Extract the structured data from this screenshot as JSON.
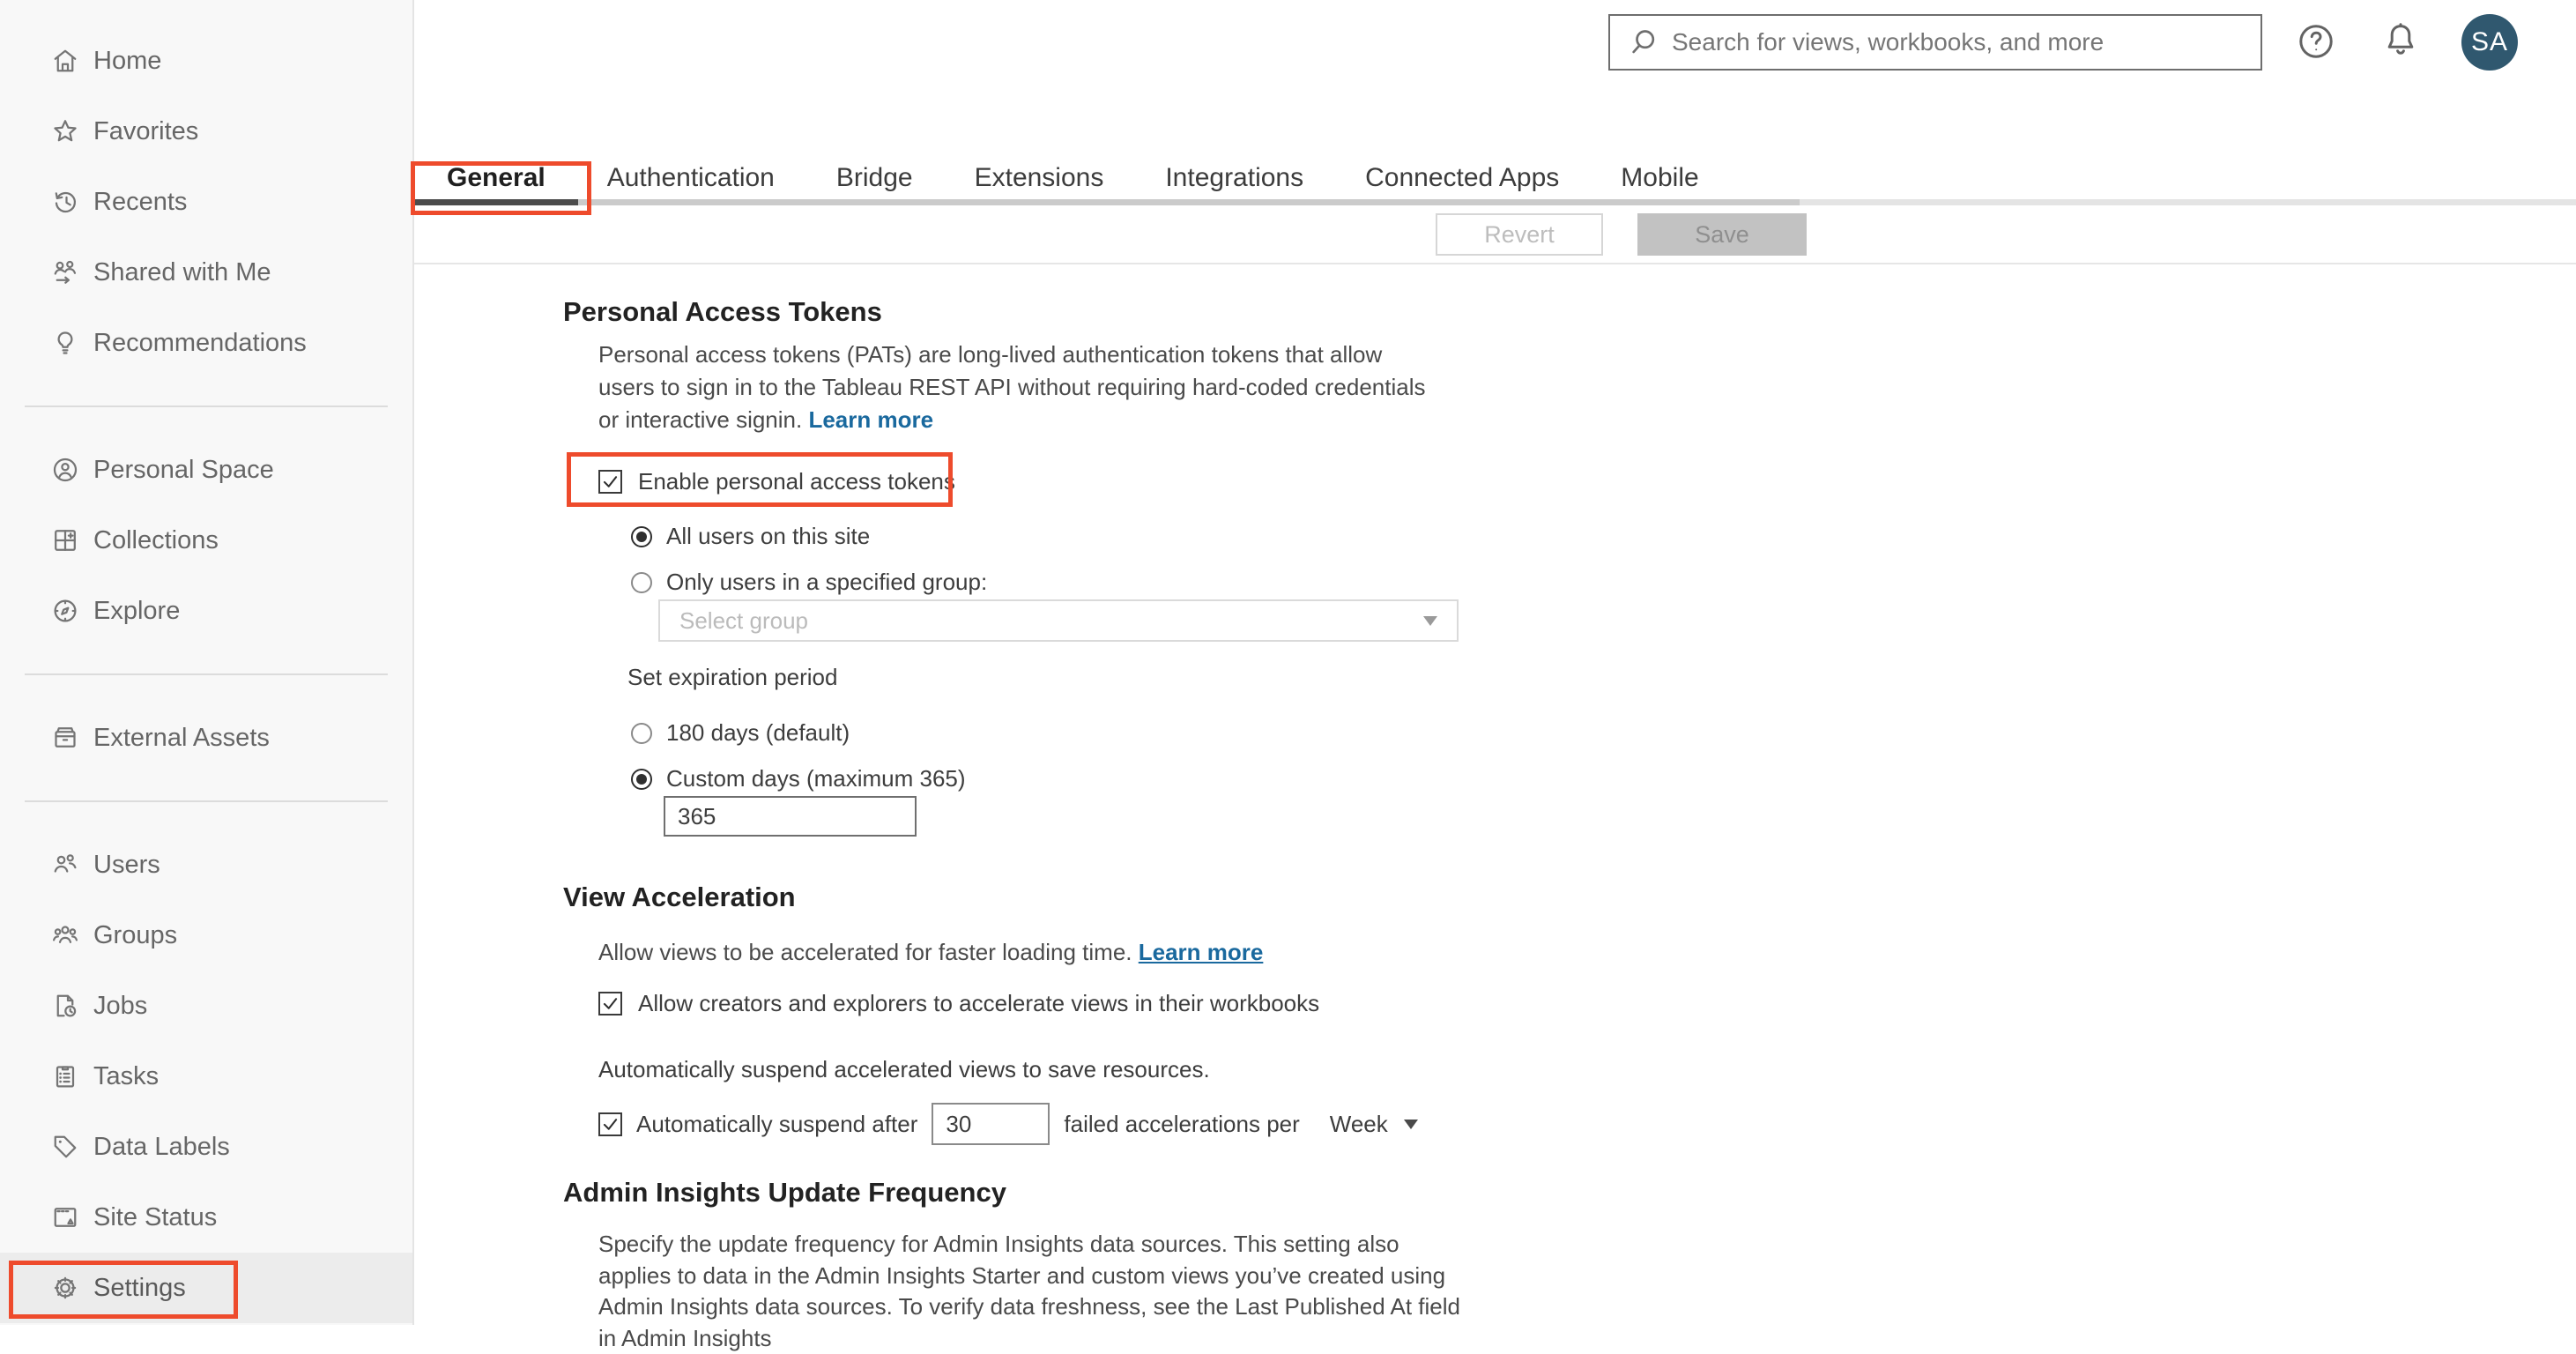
{
  "colors": {
    "annotation_red": "#ee4b2c",
    "link_blue": "#1a699e",
    "avatar_bg": "#30586f"
  },
  "topbar": {
    "search_placeholder": "Search for views, workbooks, and more",
    "avatar_initials": "SA"
  },
  "sidebar": {
    "groups": [
      {
        "items": [
          {
            "icon": "home-icon",
            "label": "Home"
          },
          {
            "icon": "star-icon",
            "label": "Favorites"
          },
          {
            "icon": "recents-icon",
            "label": "Recents"
          },
          {
            "icon": "shared-with-me-icon",
            "label": "Shared with Me"
          },
          {
            "icon": "lightbulb-icon",
            "label": "Recommendations"
          }
        ]
      },
      {
        "items": [
          {
            "icon": "person-circle-icon",
            "label": "Personal Space"
          },
          {
            "icon": "collections-icon",
            "label": "Collections"
          },
          {
            "icon": "compass-icon",
            "label": "Explore"
          }
        ]
      },
      {
        "items": [
          {
            "icon": "external-assets-icon",
            "label": "External Assets"
          }
        ]
      },
      {
        "items": [
          {
            "icon": "users-icon",
            "label": "Users"
          },
          {
            "icon": "groups-icon",
            "label": "Groups"
          },
          {
            "icon": "jobs-icon",
            "label": "Jobs"
          },
          {
            "icon": "tasks-icon",
            "label": "Tasks"
          },
          {
            "icon": "tag-icon",
            "label": "Data Labels"
          },
          {
            "icon": "site-status-icon",
            "label": "Site Status"
          },
          {
            "icon": "gear-icon",
            "label": "Settings"
          }
        ]
      }
    ]
  },
  "tabs": {
    "items": [
      {
        "label": "General",
        "active": true
      },
      {
        "label": "Authentication",
        "active": false
      },
      {
        "label": "Bridge",
        "active": false
      },
      {
        "label": "Extensions",
        "active": false
      },
      {
        "label": "Integrations",
        "active": false
      },
      {
        "label": "Connected Apps",
        "active": false
      },
      {
        "label": "Mobile",
        "active": false
      }
    ]
  },
  "actions": {
    "revert_label": "Revert",
    "save_label": "Save"
  },
  "pat": {
    "heading": "Personal Access Tokens",
    "description": "Personal access tokens (PATs) are long-lived authentication tokens that allow users to sign in to the Tableau REST API without requiring hard-coded credentials or interactive signin.",
    "learn_more": "Learn more",
    "enable_label": "Enable personal access tokens",
    "all_users_label": "All users on this site",
    "group_users_label": "Only users in a specified group:",
    "group_placeholder": "Select group",
    "expiration_label": "Set expiration period",
    "default_days_label": "180 days (default)",
    "custom_days_label": "Custom days (maximum 365)",
    "custom_days_value": "365"
  },
  "view_acceleration": {
    "heading": "View Acceleration",
    "description": "Allow views to be accelerated for faster loading time.",
    "learn_more": "Learn more",
    "allow_label": "Allow creators and explorers to accelerate views in their workbooks",
    "suspend_intro": "Automatically suspend accelerated views to save resources.",
    "suspend_prefix": "Automatically suspend after",
    "suspend_value": "30",
    "suspend_suffix": "failed accelerations per",
    "period_value": "Week"
  },
  "admin_insights": {
    "heading": "Admin Insights Update Frequency",
    "description": "Specify the update frequency for Admin Insights data sources. This setting also applies to data in the Admin Insights Starter and custom views you’ve created using Admin Insights data sources. To verify data freshness, see the Last Published At field in Admin Insights"
  }
}
